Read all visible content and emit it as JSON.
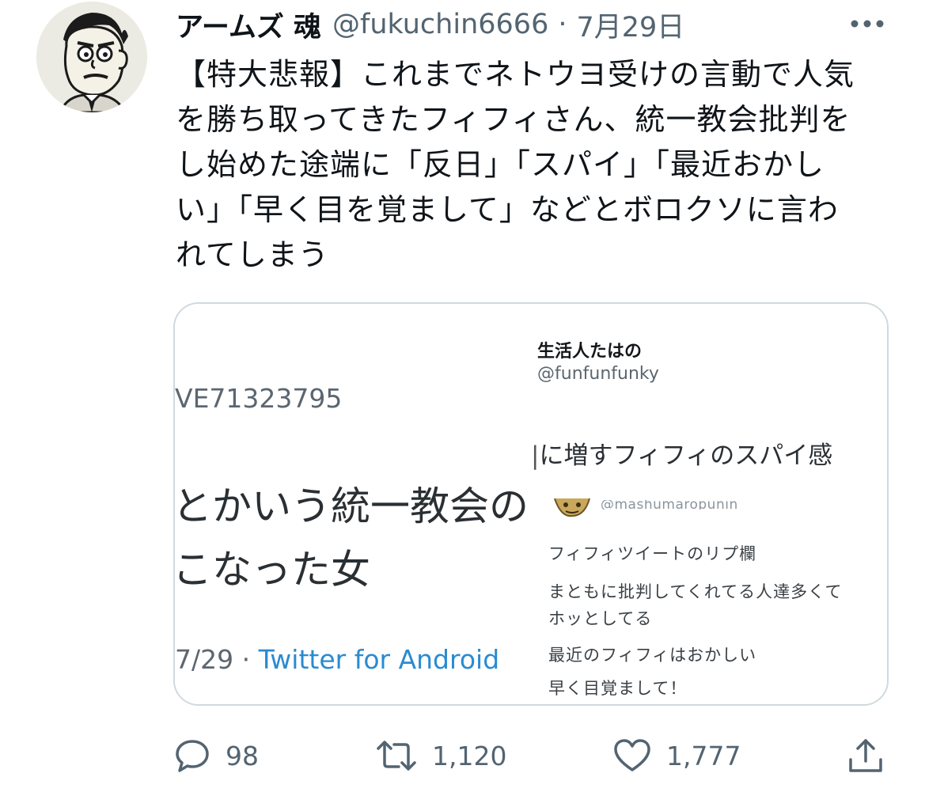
{
  "tweet": {
    "display_name": "アームズ 魂",
    "handle": "@fukuchin6666",
    "separator": "·",
    "date": "7月29日",
    "text_lines": [
      "【特大悲報】これまでネトウヨ受けの言動で人気",
      "を勝ち取ってきたフィフィさん、統一教会批判を",
      "し始めた途端に「反日」「スパイ」「最近おかし",
      "い」「早く目を覚まして」などとボロクソに言わ",
      "れてしまう"
    ]
  },
  "card": {
    "left": {
      "id_fragment": "VE71323795",
      "line1": "とかいう統一教会の",
      "line2": "こなった女",
      "footer_date": "7/29",
      "footer_sep": "·",
      "footer_source": "Twitter for Android"
    },
    "right": {
      "name": "生活人たはの",
      "handle": "@funfunfunky",
      "quote": "に増すフィフィのスパイ感",
      "sub_handle": "@mashumaropunin_",
      "replies": [
        "フィフィツイートのリプ欄",
        "まともに批判してくれてる人達多くて",
        "ホッとしてる",
        "最近のフィフィはおかしい",
        "早く目覚まして！"
      ]
    }
  },
  "actions": {
    "reply_count": "98",
    "retweet_count": "1,120",
    "like_count": "1,777"
  },
  "icons": {
    "more": "more-icon",
    "reply": "reply-icon",
    "retweet": "retweet-icon",
    "like": "like-icon",
    "share": "share-icon"
  },
  "colors": {
    "text": "#0f1419",
    "secondary": "#536471",
    "border": "#cfd9de",
    "link": "#2a8bd1"
  }
}
